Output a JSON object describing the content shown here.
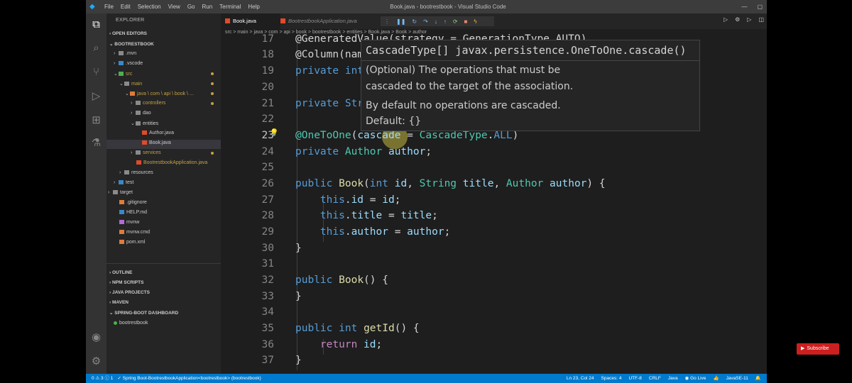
{
  "titlebar": {
    "menus": [
      "File",
      "Edit",
      "Selection",
      "View",
      "Go",
      "Run",
      "Terminal",
      "Help"
    ],
    "title": "Book.java - bootrestbook - Visual Studio Code"
  },
  "sidebar": {
    "header": "EXPLORER",
    "open_editors": "OPEN EDITORS",
    "project": "BOOTRESTBOOK",
    "tree": [
      ".mvn",
      ".vscode",
      "src",
      "main",
      "java \\ com \\ api \\ book \\ ...",
      "controllers",
      "dao",
      "entities",
      "Author.java",
      "Book.java",
      "services",
      "BootrestbookApplication.java",
      "resources",
      "test",
      "target",
      ".gitignore",
      "HELP.md",
      "mvnw",
      "mvnw.cmd",
      "pom.xml"
    ],
    "sections": [
      "OUTLINE",
      "NPM SCRIPTS",
      "JAVA PROJECTS",
      "MAVEN",
      "SPRING-BOOT DASHBOARD"
    ],
    "dashboard_item": "bootrestbook"
  },
  "tabs": [
    {
      "label": "Book.java"
    },
    {
      "label": "BootrestbookApplication.java"
    }
  ],
  "breadcrumb": "src > main > java > com > api > book > bootrestbook > entities > Book.java > Book > author",
  "editor": {
    "line_numbers": [
      "17",
      "18",
      "19",
      "20",
      "21",
      "22",
      "23",
      "24",
      "25",
      "26",
      "27",
      "28",
      "29",
      "30",
      "31",
      "32",
      "33",
      "34",
      "35",
      "36",
      "37"
    ],
    "lines": [
      "@GeneratedValue(strategy = GenerationType.AUTO)",
      "@Column(name = \"book_id\")",
      "private int id;",
      "",
      "private String title;",
      "",
      "@OneToOne(cascade = CascadeType.ALL)",
      "private Author author;",
      "",
      "public Book(int id, String title, Author author) {",
      "    this.id = id;",
      "    this.title = title;",
      "    this.author = author;",
      "}",
      "",
      "public Book() {",
      "}",
      "",
      "public int getId() {",
      "    return id;",
      "}"
    ]
  },
  "hover": {
    "signature": "CascadeType[] javax.persistence.OneToOne.cascade()",
    "doc1": "(Optional) The operations that must be",
    "doc2": "cascaded to the target of the association.",
    "doc3": "By default no operations are cascaded.",
    "doc4": "Default: {}"
  },
  "status": {
    "problems": "0 ⚠ 3 ⓘ 1",
    "spring": "Spring Boot-BootrestbookApplication<bootrestbook> (bootrestbook)",
    "position": "Ln 23, Col 24",
    "spaces": "Spaces: 4",
    "encoding": "UTF-8",
    "eol": "CRLF",
    "language": "Java",
    "golive": "Go Live",
    "java": "JavaSE-11"
  },
  "overlay": {
    "subscribe": "Subscribe"
  }
}
